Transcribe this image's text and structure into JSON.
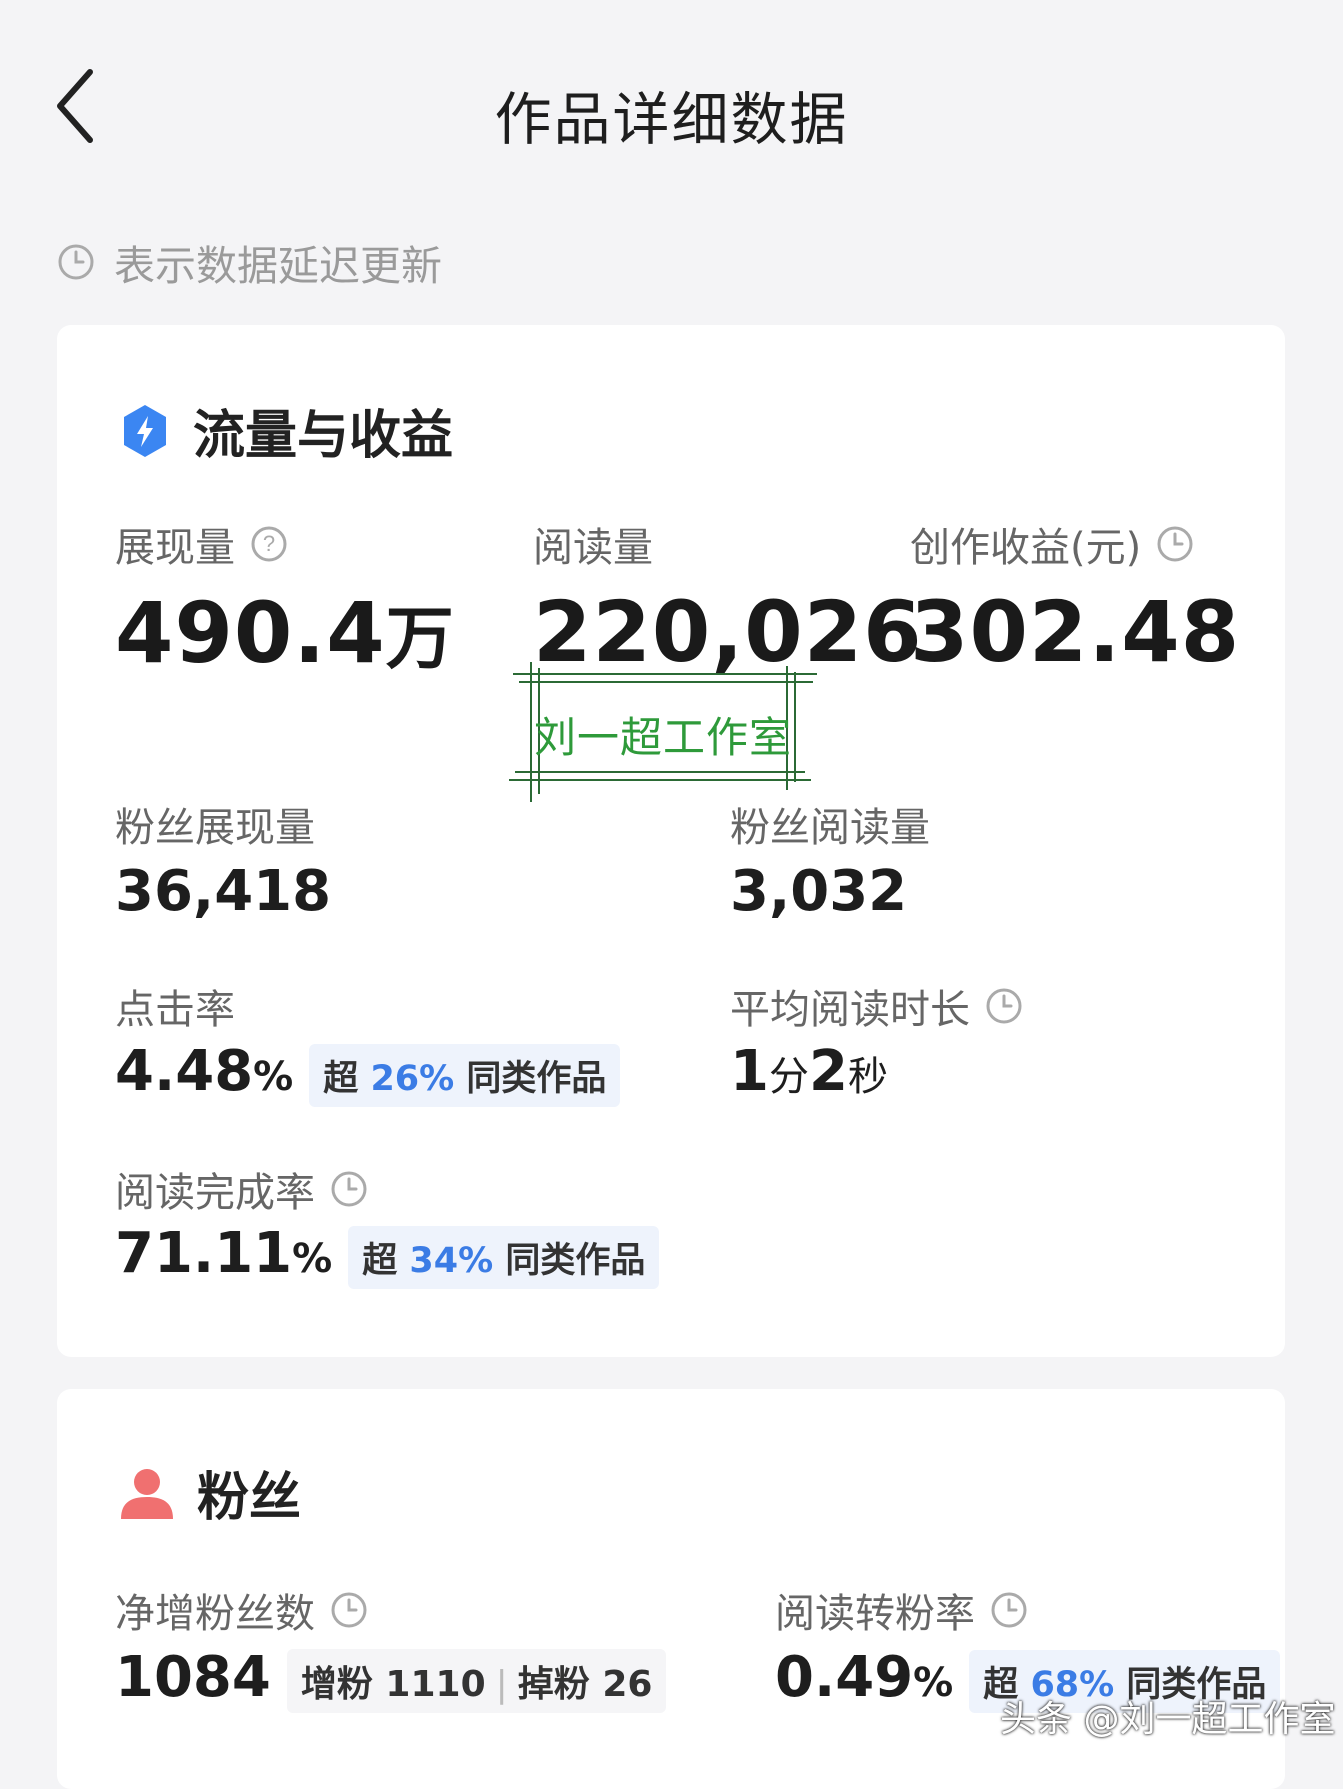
{
  "header": {
    "title": "作品详细数据"
  },
  "notice": {
    "text": "表示数据延迟更新"
  },
  "traffic": {
    "title": "流量与收益",
    "impressions": {
      "label": "展现量",
      "value": "490.4",
      "unit": "万"
    },
    "reads": {
      "label": "阅读量",
      "value": "220,026"
    },
    "earnings": {
      "label": "创作收益(元)",
      "value": "302.48"
    },
    "fan_impressions": {
      "label": "粉丝展现量",
      "value": "36,418"
    },
    "fan_reads": {
      "label": "粉丝阅读量",
      "value": "3,032"
    },
    "ctr": {
      "label": "点击率",
      "value": "4.48",
      "pct": "%",
      "badge_pre": "超",
      "badge_val": "26%",
      "badge_post": "同类作品"
    },
    "avg_read": {
      "label": "平均阅读时长",
      "num1": "1",
      "u1": "分",
      "num2": "2",
      "u2": "秒"
    },
    "completion": {
      "label": "阅读完成率",
      "value": "71.11",
      "pct": "%",
      "badge_pre": "超",
      "badge_val": "34%",
      "badge_post": "同类作品"
    }
  },
  "stamp": {
    "text": "刘一超工作室"
  },
  "fans": {
    "title": "粉丝",
    "net": {
      "label": "净增粉丝数",
      "value": "1084",
      "gain_label": "增粉",
      "gain": "1110",
      "loss_label": "掉粉",
      "loss": "26"
    },
    "conv": {
      "label": "阅读转粉率",
      "value": "0.49",
      "pct": "%",
      "badge_pre": "超",
      "badge_val": "68%",
      "badge_post": "同类作品"
    }
  },
  "watermark": {
    "text": "头条 @刘一超工作室"
  },
  "icons": [
    "back-icon",
    "clock-icon",
    "help-icon",
    "traffic-icon",
    "fans-icon"
  ],
  "colors": {
    "accent": "#3b7ce5",
    "fans_icon": "#f07070",
    "stamp": "#2e9a3a"
  }
}
